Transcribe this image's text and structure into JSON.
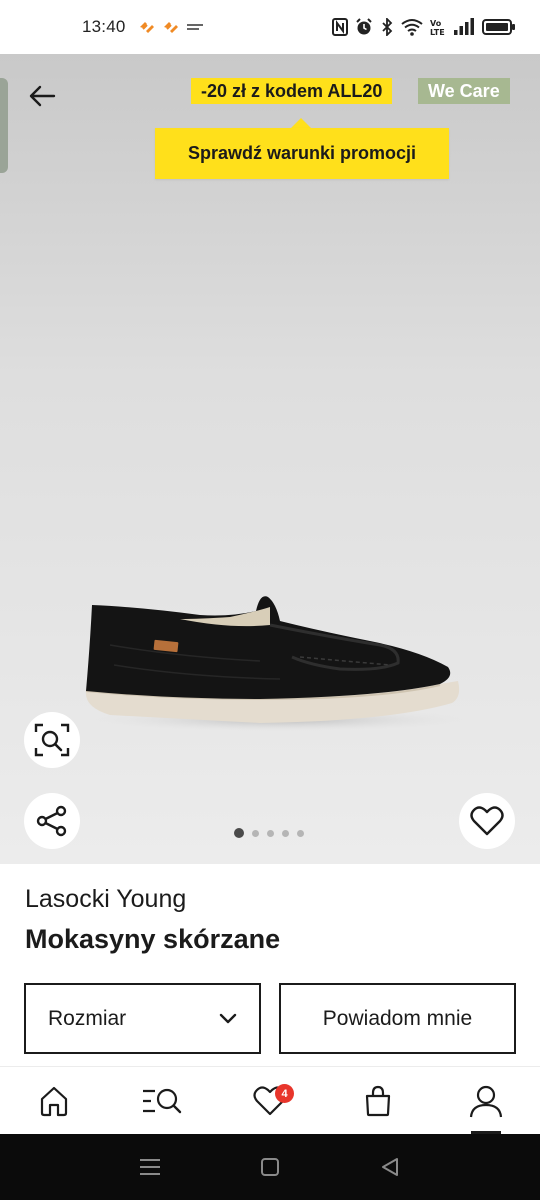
{
  "status_bar": {
    "time": "13:40",
    "left_icons": [
      "app-notification-icon",
      "app-notification-icon",
      "app-small-icon"
    ],
    "right_icons": [
      "nfc-icon",
      "alarm-icon",
      "bluetooth-icon",
      "wifi-icon",
      "volte-icon",
      "signal-icon",
      "battery-icon"
    ]
  },
  "header": {
    "promo_label": "-20 zł z kodem ALL20",
    "care_label": "We Care",
    "tooltip_label": "Sprawdź warunki promocji"
  },
  "gallery": {
    "image_count": 5,
    "active_index": 0
  },
  "product": {
    "brand": "Lasocki Young",
    "name": "Mokasyny skórzane"
  },
  "actions": {
    "size_label": "Rozmiar",
    "notify_label": "Powiadom mnie"
  },
  "bottom_nav": {
    "items": [
      "home-icon",
      "search-menu-icon",
      "heart-icon",
      "bag-icon",
      "user-icon"
    ],
    "favorites_count": "4",
    "active": "user"
  },
  "colors": {
    "promo_yellow": "#ffe01b",
    "care_green": "#a7b891",
    "badge_red": "#e8352b",
    "text_dark": "#1b1b1b"
  }
}
